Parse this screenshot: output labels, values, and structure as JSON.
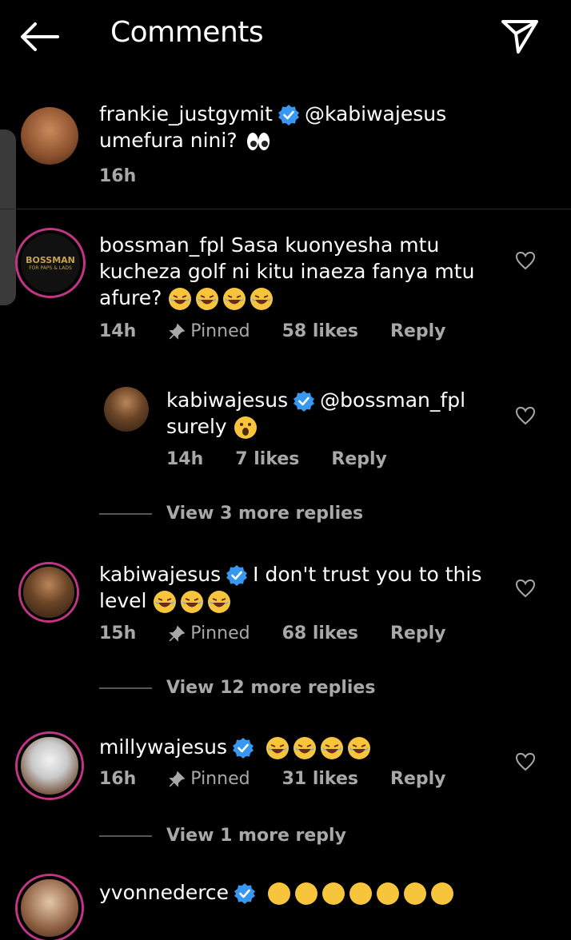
{
  "header": {
    "title": "Comments"
  },
  "caption": {
    "username": "frankie_justgymit",
    "mention": "@kabiwajesus",
    "text": "umefura nini?",
    "time": "16h"
  },
  "comments": [
    {
      "username": "bossman_fpl",
      "text": "Sasa kuonyesha mtu kucheza golf ni kitu inaeza fanya mtu afure?",
      "time": "14h",
      "pinned": "Pinned",
      "likes": "58 likes",
      "reply": "Reply",
      "avatar_label": "BOSSMAN",
      "avatar_sub": "FOR PAPS & LADS"
    },
    {
      "username": "kabiwajesus",
      "mention": "@bossman_fpl",
      "text": "surely",
      "time": "14h",
      "likes": "7 likes",
      "reply": "Reply"
    },
    {
      "view_more": "View 3 more replies"
    },
    {
      "username": "kabiwajesus",
      "text": "I don't trust you to this level",
      "time": "15h",
      "pinned": "Pinned",
      "likes": "68 likes",
      "reply": "Reply"
    },
    {
      "view_more": "View 12 more replies"
    },
    {
      "username": "millywajesus",
      "time": "16h",
      "pinned": "Pinned",
      "likes": "31 likes",
      "reply": "Reply"
    },
    {
      "view_more": "View 1 more reply"
    },
    {
      "username": "yvonnederce"
    }
  ],
  "colors": {
    "verified": "#3897f0",
    "secondary_text": "#a8a8a8",
    "story_ring": "#c13584"
  }
}
